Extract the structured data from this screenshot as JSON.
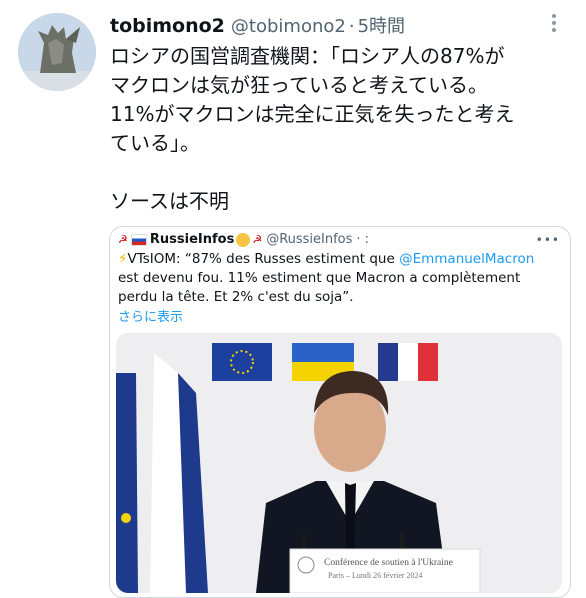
{
  "tweet": {
    "display_name": "tobimono2",
    "handle": "@tobimono2",
    "separator": "·",
    "time": "5時間",
    "text": "ロシアの国営調査機関：「ロシア人の87%が\nマクロンは気が狂っていると考えている。\n11%がマクロンは完全に正気を失ったと考え\nている」。\n\nソースは不明"
  },
  "quote": {
    "name": "RussieInfos",
    "handle": "@RussieInfos",
    "more": "· :",
    "text_prefix": "VTsIOM: “87% des Russes estiment que ",
    "mention": "@EmmanuelMacron",
    "text_suffix": " est devenu fou. 11% estiment que Macron a complètement perdu la tête. Et 2% c'est du soja”.",
    "show_more": "さらに表示",
    "podium_line1": "Conférence de soutien à l'Ukraine",
    "podium_line2": "Paris – Lundi 26 février 2024"
  },
  "colors": {
    "link": "#1d9bf0",
    "secondary": "#536471",
    "eu_blue": "#1d3f9e",
    "ukraine_blue": "#2a62c7",
    "ukraine_yellow": "#f5d300",
    "fr_blue": "#233a8f",
    "fr_red": "#e0303a"
  },
  "icons": [
    "more-icon",
    "russia-flag-icon",
    "hammer-sickle-icon",
    "emoji-icon",
    "lightning-icon"
  ]
}
